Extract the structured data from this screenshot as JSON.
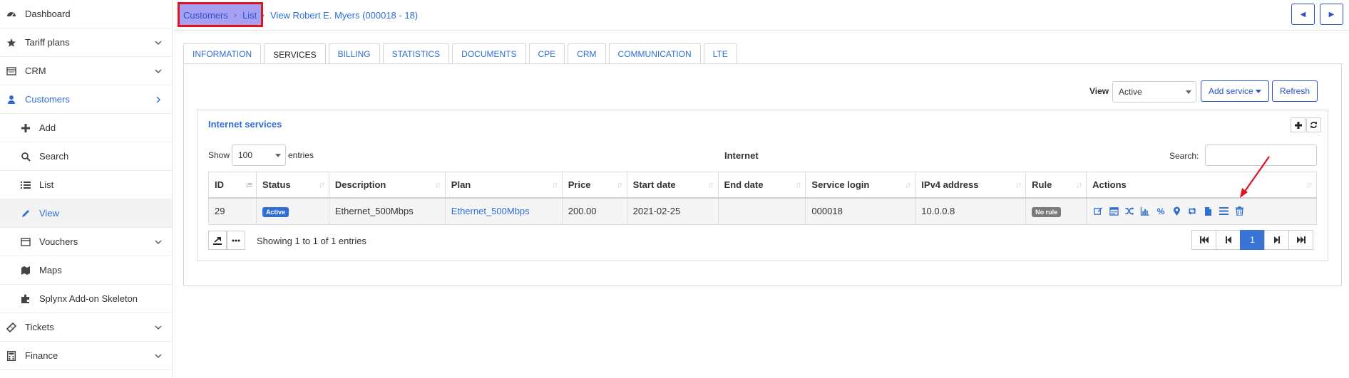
{
  "sidebar": {
    "items": [
      {
        "label": "Dashboard"
      },
      {
        "label": "Tariff plans"
      },
      {
        "label": "CRM"
      },
      {
        "label": "Customers"
      },
      {
        "label": "Add"
      },
      {
        "label": "Search"
      },
      {
        "label": "List"
      },
      {
        "label": "View"
      },
      {
        "label": "Vouchers"
      },
      {
        "label": "Maps"
      },
      {
        "label": "Splynx Add-on Skeleton"
      },
      {
        "label": "Tickets"
      },
      {
        "label": "Finance"
      }
    ]
  },
  "breadcrumb": {
    "customers": "Customers",
    "separator": "›",
    "list": "List",
    "view": "View Robert E. Myers (000018 - 18)"
  },
  "tabs": [
    "INFORMATION",
    "SERVICES",
    "BILLING",
    "STATISTICS",
    "DOCUMENTS",
    "CPE",
    "CRM",
    "COMMUNICATION",
    "LTE"
  ],
  "toolbar": {
    "view_label": "View",
    "view_value": "Active",
    "add_service": "Add service",
    "refresh": "Refresh"
  },
  "section": {
    "title": "Internet services",
    "show_label": "Show",
    "page_size": "100",
    "entries_label": "entries",
    "group_label": "Internet",
    "search_label": "Search:",
    "search_value": ""
  },
  "table": {
    "columns": [
      "ID",
      "Status",
      "Description",
      "Plan",
      "Price",
      "Start date",
      "End date",
      "Service login",
      "IPv4 address",
      "Rule",
      "Actions"
    ],
    "rows": [
      {
        "id": "29",
        "status": "Active",
        "description": "Ethernet_500Mbps",
        "plan": "Ethernet_500Mbps",
        "price": "200.00",
        "start_date": "2021-02-25",
        "end_date": "",
        "service_login": "000018",
        "ipv4": "10.0.0.8",
        "rule": "No rule"
      }
    ]
  },
  "footer": {
    "info": "Showing 1 to 1 of 1 entries",
    "current_page": "1"
  },
  "colors": {
    "accent": "#2f6ed5",
    "highlight_box": "#a6a0f5",
    "highlight_border": "#e0141e",
    "arrow": "#e0141e"
  }
}
